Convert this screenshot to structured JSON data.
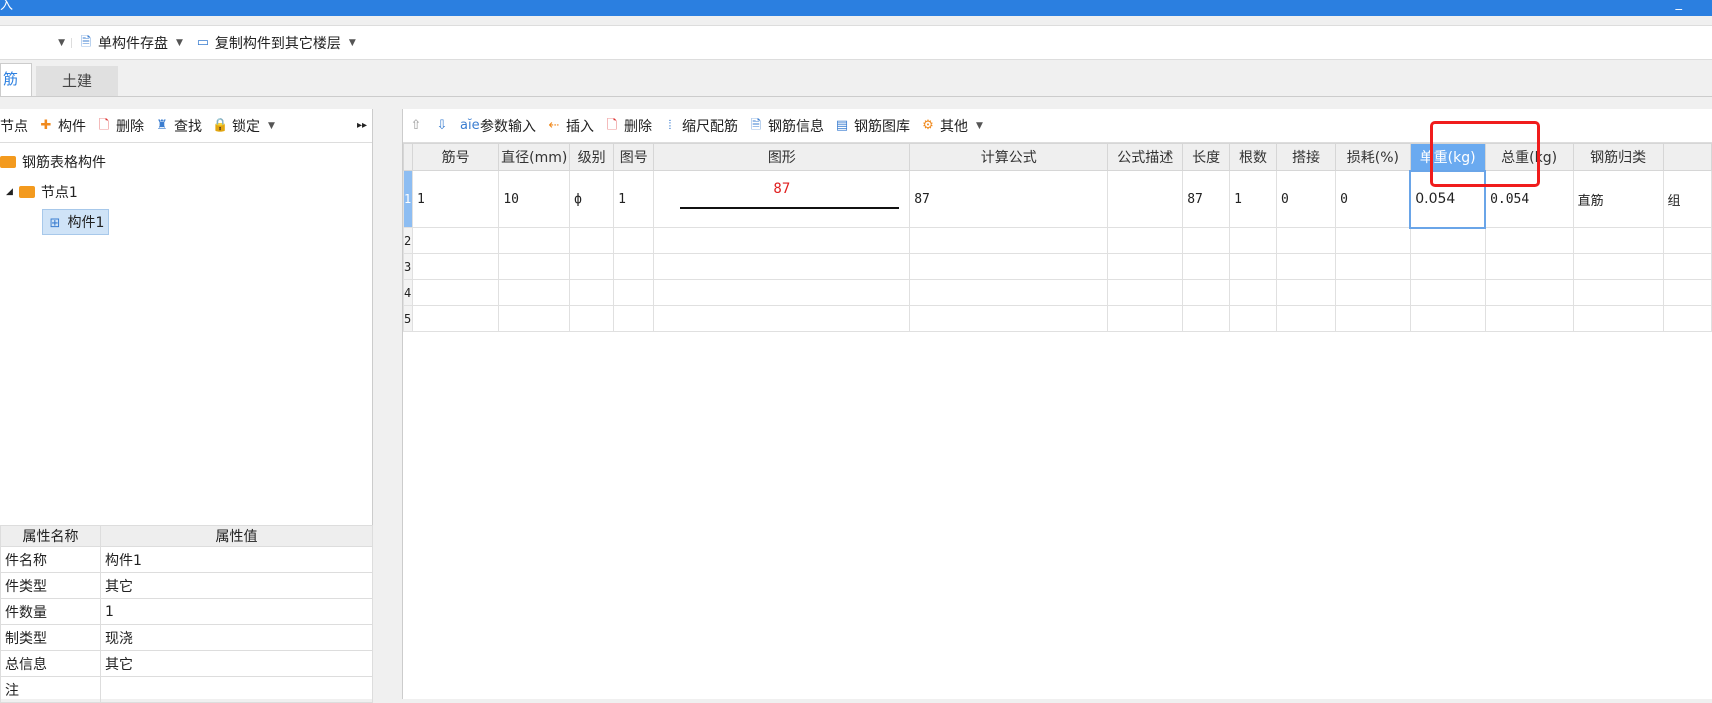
{
  "title": "入",
  "toolbar": {
    "save_component": "单构件存盘",
    "copy_to_floor": "复制构件到其它楼层"
  },
  "tabs": [
    {
      "label": "筋"
    },
    {
      "label": "土建"
    }
  ],
  "left_toolbar": {
    "node": "节点",
    "component": "构件",
    "delete": "删除",
    "find": "查找",
    "lock": "锁定"
  },
  "tree": {
    "root": "钢筋表格构件",
    "node": "节点1",
    "component": "构件1"
  },
  "props": {
    "headers": [
      "属性名称",
      "属性值"
    ],
    "rows": [
      [
        "件名称",
        "构件1"
      ],
      [
        "件类型",
        "其它"
      ],
      [
        "件数量",
        "1"
      ],
      [
        "制类型",
        "现浇"
      ],
      [
        "总信息",
        "其它"
      ],
      [
        "注",
        ""
      ]
    ]
  },
  "right_toolbar": {
    "param_input": "参数输入",
    "insert": "插入",
    "delete": "删除",
    "scale": "缩尺配筋",
    "info": "钢筋信息",
    "library": "钢筋图库",
    "other": "其他"
  },
  "grid": {
    "headers": [
      "筋号",
      "直径(mm)",
      "级别",
      "图号",
      "图形",
      "计算公式",
      "公式描述",
      "长度",
      "根数",
      "搭接",
      "损耗(%)",
      "单重(kg)",
      "总重(kg)",
      "钢筋归类",
      ""
    ],
    "rows": [
      {
        "num": "1",
        "cells": [
          "1",
          "10",
          "ф",
          "1",
          "87",
          "87",
          "",
          "87",
          "1",
          "0",
          "0",
          "0.054",
          "0.054",
          "直筋",
          "组"
        ]
      },
      {
        "num": "2",
        "cells": [
          "",
          "",
          "",
          "",
          "",
          "",
          "",
          "",
          "",
          "",
          "",
          "",
          "",
          "",
          ""
        ]
      },
      {
        "num": "3",
        "cells": [
          "",
          "",
          "",
          "",
          "",
          "",
          "",
          "",
          "",
          "",
          "",
          "",
          "",
          "",
          ""
        ]
      },
      {
        "num": "4",
        "cells": [
          "",
          "",
          "",
          "",
          "",
          "",
          "",
          "",
          "",
          "",
          "",
          "",
          "",
          "",
          ""
        ]
      },
      {
        "num": "5",
        "cells": [
          "",
          "",
          "",
          "",
          "",
          "",
          "",
          "",
          "",
          "",
          "",
          "",
          "",
          "",
          ""
        ]
      }
    ]
  },
  "highlight_color": "#f01c1c",
  "accent": "#2b7fe0"
}
